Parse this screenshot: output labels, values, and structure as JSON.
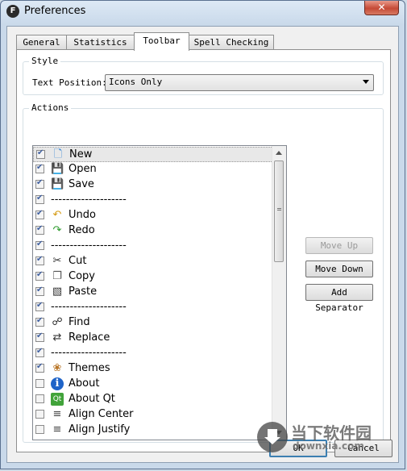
{
  "window": {
    "title": "Preferences",
    "app_icon": "F",
    "close_label": "✕"
  },
  "tabs": [
    {
      "label": "General"
    },
    {
      "label": "Statistics"
    },
    {
      "label": "Toolbar"
    },
    {
      "label": "Spell Checking"
    }
  ],
  "style_group": {
    "title": "Style",
    "text_position_label": "Text Position:",
    "text_position_value": "Icons Only"
  },
  "actions_group": {
    "title": "Actions",
    "items": [
      {
        "label": "New",
        "checked": true,
        "icon": "new-icon",
        "glyph": "🗋"
      },
      {
        "label": "Open",
        "checked": true,
        "icon": "open-icon",
        "glyph": "💾"
      },
      {
        "label": "Save",
        "checked": true,
        "icon": "save-icon",
        "glyph": "💾"
      },
      {
        "label": "--------------------",
        "checked": true,
        "separator": true
      },
      {
        "label": "Undo",
        "checked": true,
        "icon": "undo-icon",
        "glyph": "↶"
      },
      {
        "label": "Redo",
        "checked": true,
        "icon": "redo-icon",
        "glyph": "↷"
      },
      {
        "label": "--------------------",
        "checked": true,
        "separator": true
      },
      {
        "label": "Cut",
        "checked": true,
        "icon": "cut-icon",
        "glyph": "✂"
      },
      {
        "label": "Copy",
        "checked": true,
        "icon": "copy-icon",
        "glyph": "❐"
      },
      {
        "label": "Paste",
        "checked": true,
        "icon": "paste-icon",
        "glyph": "▧"
      },
      {
        "label": "--------------------",
        "checked": true,
        "separator": true
      },
      {
        "label": "Find",
        "checked": true,
        "icon": "binoculars-icon",
        "glyph": "☍"
      },
      {
        "label": "Replace",
        "checked": true,
        "icon": "replace-icon",
        "glyph": "⇄"
      },
      {
        "label": "--------------------",
        "checked": true,
        "separator": true
      },
      {
        "label": "Themes",
        "checked": true,
        "icon": "palette-icon",
        "glyph": "❀"
      },
      {
        "label": "About",
        "checked": false,
        "icon": "info-icon",
        "glyph": "ℹ"
      },
      {
        "label": "About Qt",
        "checked": false,
        "icon": "qt-icon",
        "glyph": "Qt"
      },
      {
        "label": "Align Center",
        "checked": false,
        "icon": "align-center-icon",
        "glyph": "≡"
      },
      {
        "label": "Align Justify",
        "checked": false,
        "icon": "align-justify-icon",
        "glyph": "≡"
      }
    ]
  },
  "buttons": {
    "move_up": "Move Up",
    "move_down": "Move Down",
    "add_separator": "Add Separator",
    "ok": "OK",
    "cancel": "Cancel"
  },
  "watermark": {
    "text": "当下软件园",
    "sub": "downxia.com"
  }
}
